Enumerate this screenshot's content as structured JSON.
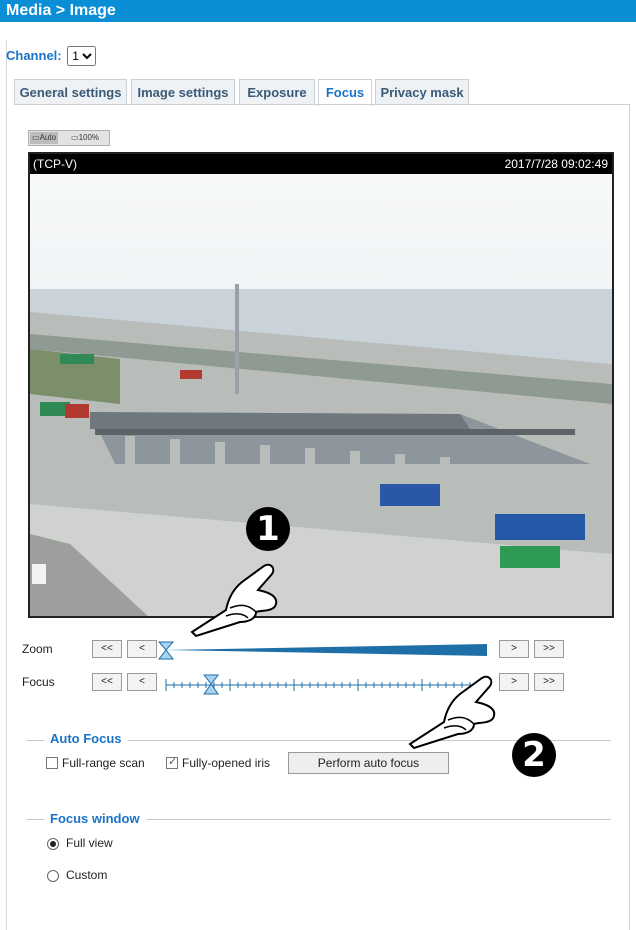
{
  "header": {
    "title": "Media > Image"
  },
  "channel": {
    "label": "Channel:",
    "value": "1"
  },
  "tabs": [
    {
      "label": "General settings"
    },
    {
      "label": "Image settings"
    },
    {
      "label": "Exposure"
    },
    {
      "label": "Focus",
      "active": true
    },
    {
      "label": "Privacy mask"
    }
  ],
  "view_buttons": {
    "auto": "Auto",
    "full": "100%"
  },
  "video": {
    "source": "(TCP-V)",
    "timestamp": "2017/7/28 09:02:49"
  },
  "zoom": {
    "label": "Zoom",
    "btn_far": "<<",
    "btn_near": "<",
    "btn_next": ">",
    "btn_last": ">>",
    "level": 0.0
  },
  "focus": {
    "label": "Focus",
    "btn_far": "<<",
    "btn_near": "<",
    "btn_next": ">",
    "btn_last": ">>",
    "level": 0.14
  },
  "auto_focus": {
    "title": "Auto Focus",
    "full_range_scan": {
      "label": "Full-range scan",
      "checked": false
    },
    "fully_opened_iris": {
      "label": "Fully-opened iris",
      "checked": true
    },
    "perform_button": "Perform auto focus"
  },
  "focus_window": {
    "title": "Focus window",
    "options": [
      {
        "label": "Full view",
        "selected": true
      },
      {
        "label": "Custom",
        "selected": false
      }
    ]
  },
  "callouts": {
    "one": "1",
    "two": "2"
  },
  "colors": {
    "accent": "#0a8fd6",
    "title_blue": "#1a73c7",
    "slider": "#1e6fa8"
  }
}
